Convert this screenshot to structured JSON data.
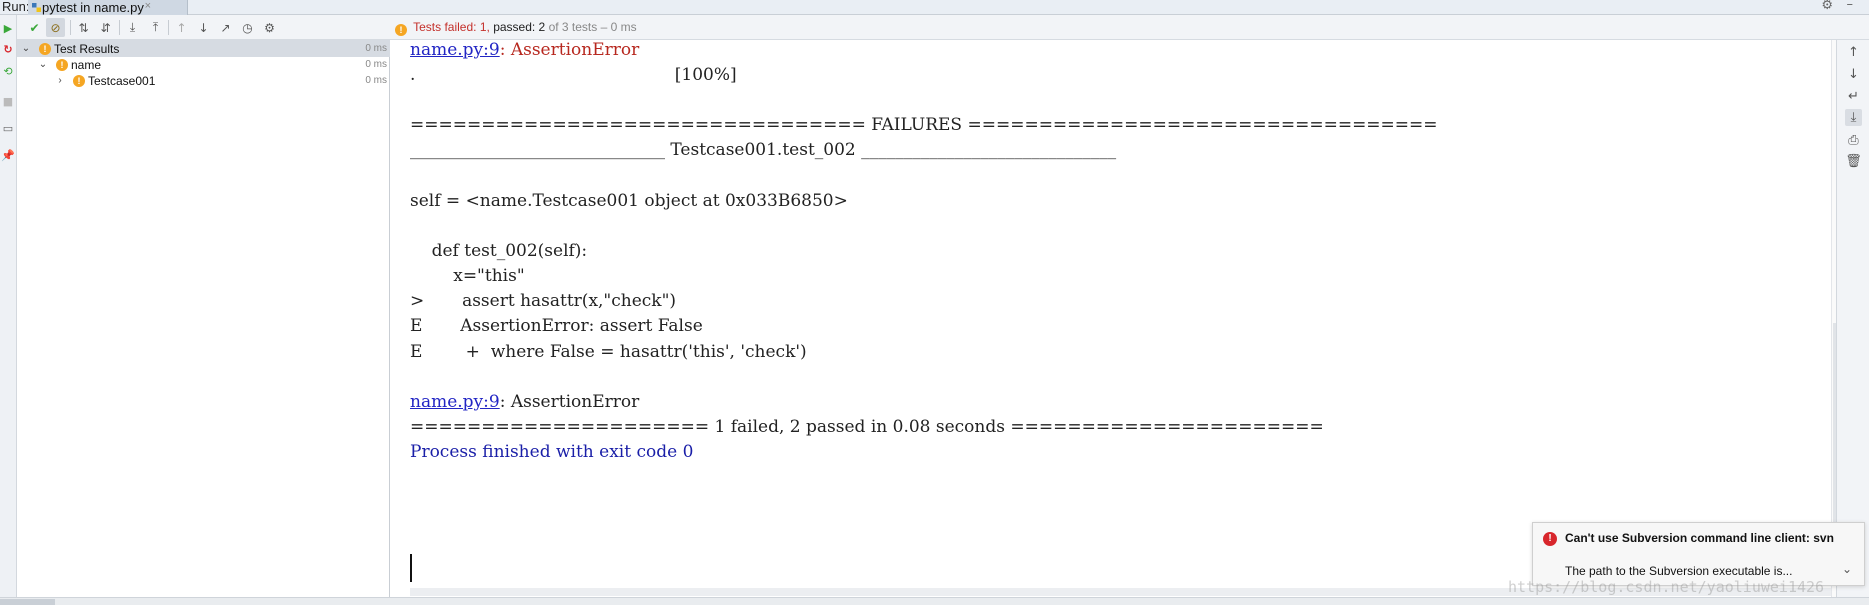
{
  "window": {
    "run_label": "Run:",
    "run_tab_label": "pytest in name.py",
    "close_glyph": "×"
  },
  "toolbar": {
    "status_failed_label": "Tests failed: 1,",
    "status_passed_label": "passed: 2",
    "status_suffix": "of 3 tests – 0 ms",
    "status_color_failed": "#c4302b"
  },
  "tree": {
    "rows": [
      {
        "label": "Test Results",
        "time": "0 ms",
        "expanded": true,
        "status": "warning"
      },
      {
        "label": "name",
        "time": "0 ms",
        "expanded": true,
        "status": "warning"
      },
      {
        "label": "Testcase001",
        "time": "0 ms",
        "expanded": false,
        "status": "warning"
      }
    ]
  },
  "console": {
    "lines": [
      {
        "link": "name.py:9",
        "rest": ": AssertionError",
        "rest_class": "err"
      },
      {
        "text": ".                                                [100%]"
      },
      {
        "text": ""
      },
      {
        "text": "================================ FAILURES ================================="
      },
      {
        "text": "______________________________ Testcase001.test_002 ______________________________"
      },
      {
        "text": ""
      },
      {
        "text": "self = <name.Testcase001 object at 0x033B6850>"
      },
      {
        "text": ""
      },
      {
        "text": "    def test_002(self):"
      },
      {
        "text": "        x=\"this\""
      },
      {
        "text": ">       assert hasattr(x,\"check\")"
      },
      {
        "text": "E       AssertionError: assert False"
      },
      {
        "text": "E        +  where False = hasattr('this', 'check')"
      },
      {
        "text": ""
      },
      {
        "link": "name.py:9",
        "rest": ": AssertionError",
        "rest_class": ""
      },
      {
        "text": "===================== 1 failed, 2 passed in 0.08 seconds ======================"
      },
      {
        "text": "Process finished with exit code 0",
        "class": "blue"
      }
    ]
  },
  "notification": {
    "title": "Can't use Subversion command line client: svn",
    "body": "The path to the Subversion executable is..."
  },
  "watermark": "https://blog.csdn.net/yaoliuwei1426"
}
